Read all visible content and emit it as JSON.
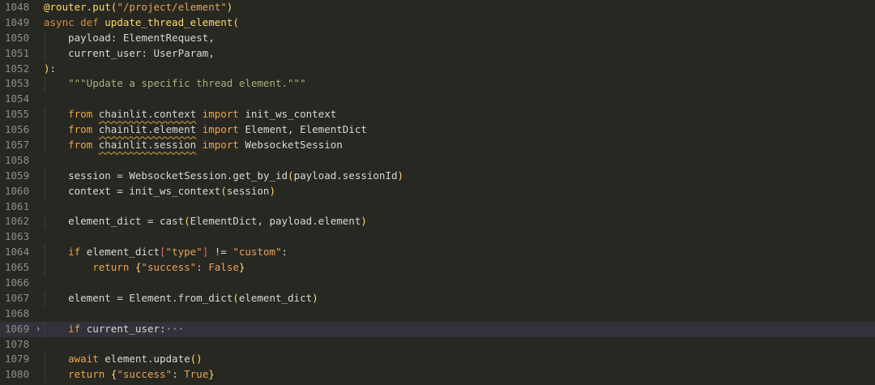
{
  "editor": {
    "lines": [
      {
        "num": "1048",
        "tokens": [
          [
            "deco",
            "@router.put("
          ],
          [
            "str",
            "\"/project/element\""
          ],
          [
            "deco",
            ")"
          ]
        ]
      },
      {
        "num": "1049",
        "tokens": [
          [
            "def",
            "async def "
          ],
          [
            "fn",
            "update_thread_element"
          ],
          [
            "paren",
            "("
          ]
        ]
      },
      {
        "num": "1050",
        "tokens": [
          [
            "txt",
            "    payload: ElementRequest,"
          ]
        ]
      },
      {
        "num": "1051",
        "tokens": [
          [
            "txt",
            "    current_user: UserParam,"
          ]
        ]
      },
      {
        "num": "1052",
        "tokens": [
          [
            "paren",
            ")"
          ],
          [
            "txt",
            ":"
          ]
        ]
      },
      {
        "num": "1053",
        "tokens": [
          [
            "docstr",
            "    \"\"\"Update a specific thread element.\"\"\""
          ]
        ]
      },
      {
        "num": "1054",
        "tokens": []
      },
      {
        "num": "1055",
        "tokens": [
          [
            "kw",
            "    from "
          ],
          [
            "mod",
            "chainlit.context"
          ],
          [
            "kw",
            " import "
          ],
          [
            "txt",
            "init_ws_context"
          ]
        ]
      },
      {
        "num": "1056",
        "tokens": [
          [
            "kw",
            "    from "
          ],
          [
            "mod",
            "chainlit.element"
          ],
          [
            "kw",
            " import "
          ],
          [
            "txt",
            "Element, ElementDict"
          ]
        ]
      },
      {
        "num": "1057",
        "tokens": [
          [
            "kw",
            "    from "
          ],
          [
            "mod",
            "chainlit.session"
          ],
          [
            "kw",
            " import "
          ],
          [
            "txt",
            "WebsocketSession"
          ]
        ]
      },
      {
        "num": "1058",
        "tokens": []
      },
      {
        "num": "1059",
        "tokens": [
          [
            "txt",
            "    session = WebsocketSession.get_by_id"
          ],
          [
            "paren",
            "("
          ],
          [
            "txt",
            "payload.sessionId"
          ],
          [
            "paren",
            ")"
          ]
        ]
      },
      {
        "num": "1060",
        "tokens": [
          [
            "txt",
            "    context = init_ws_context"
          ],
          [
            "paren",
            "("
          ],
          [
            "txt",
            "session"
          ],
          [
            "paren",
            ")"
          ]
        ]
      },
      {
        "num": "1061",
        "tokens": []
      },
      {
        "num": "1062",
        "tokens": [
          [
            "txt",
            "    element_dict = cast"
          ],
          [
            "paren",
            "("
          ],
          [
            "txt",
            "ElementDict, payload.element"
          ],
          [
            "paren",
            ")"
          ]
        ]
      },
      {
        "num": "1063",
        "tokens": []
      },
      {
        "num": "1064",
        "tokens": [
          [
            "kw",
            "    if "
          ],
          [
            "txt",
            "element_dict"
          ],
          [
            "brk",
            "["
          ],
          [
            "str",
            "\"type\""
          ],
          [
            "brk",
            "]"
          ],
          [
            "txt",
            " != "
          ],
          [
            "str",
            "\"custom\""
          ],
          [
            "txt",
            ":"
          ]
        ]
      },
      {
        "num": "1065",
        "tokens": [
          [
            "kw",
            "        return "
          ],
          [
            "paren",
            "{"
          ],
          [
            "str",
            "\"success\""
          ],
          [
            "txt",
            ": "
          ],
          [
            "const",
            "False"
          ],
          [
            "paren",
            "}"
          ]
        ]
      },
      {
        "num": "1066",
        "tokens": []
      },
      {
        "num": "1067",
        "tokens": [
          [
            "txt",
            "    element = Element.from_dict"
          ],
          [
            "paren",
            "("
          ],
          [
            "txt",
            "element_dict"
          ],
          [
            "paren",
            ")"
          ]
        ]
      },
      {
        "num": "1068",
        "tokens": []
      },
      {
        "num": "1069",
        "fold": "›",
        "highlight": true,
        "tokens": [
          [
            "kw",
            "    if "
          ],
          [
            "txt",
            "current_user:"
          ],
          [
            "ellipsis",
            "···"
          ]
        ]
      },
      {
        "num": "1078",
        "tokens": []
      },
      {
        "num": "1079",
        "tokens": [
          [
            "kw",
            "    await "
          ],
          [
            "txt",
            "element.update"
          ],
          [
            "paren",
            "()"
          ]
        ]
      },
      {
        "num": "1080",
        "tokens": [
          [
            "kw",
            "    return "
          ],
          [
            "paren",
            "{"
          ],
          [
            "str",
            "\"success\""
          ],
          [
            "txt",
            ": "
          ],
          [
            "const",
            "True"
          ],
          [
            "paren",
            "}"
          ]
        ]
      }
    ]
  },
  "colors": {
    "background": "#272822",
    "keyword": "#f2a343",
    "function": "#ffd866",
    "string": "#e6a05a",
    "docstring": "#a8b07a",
    "line_number": "#8e8e88"
  }
}
